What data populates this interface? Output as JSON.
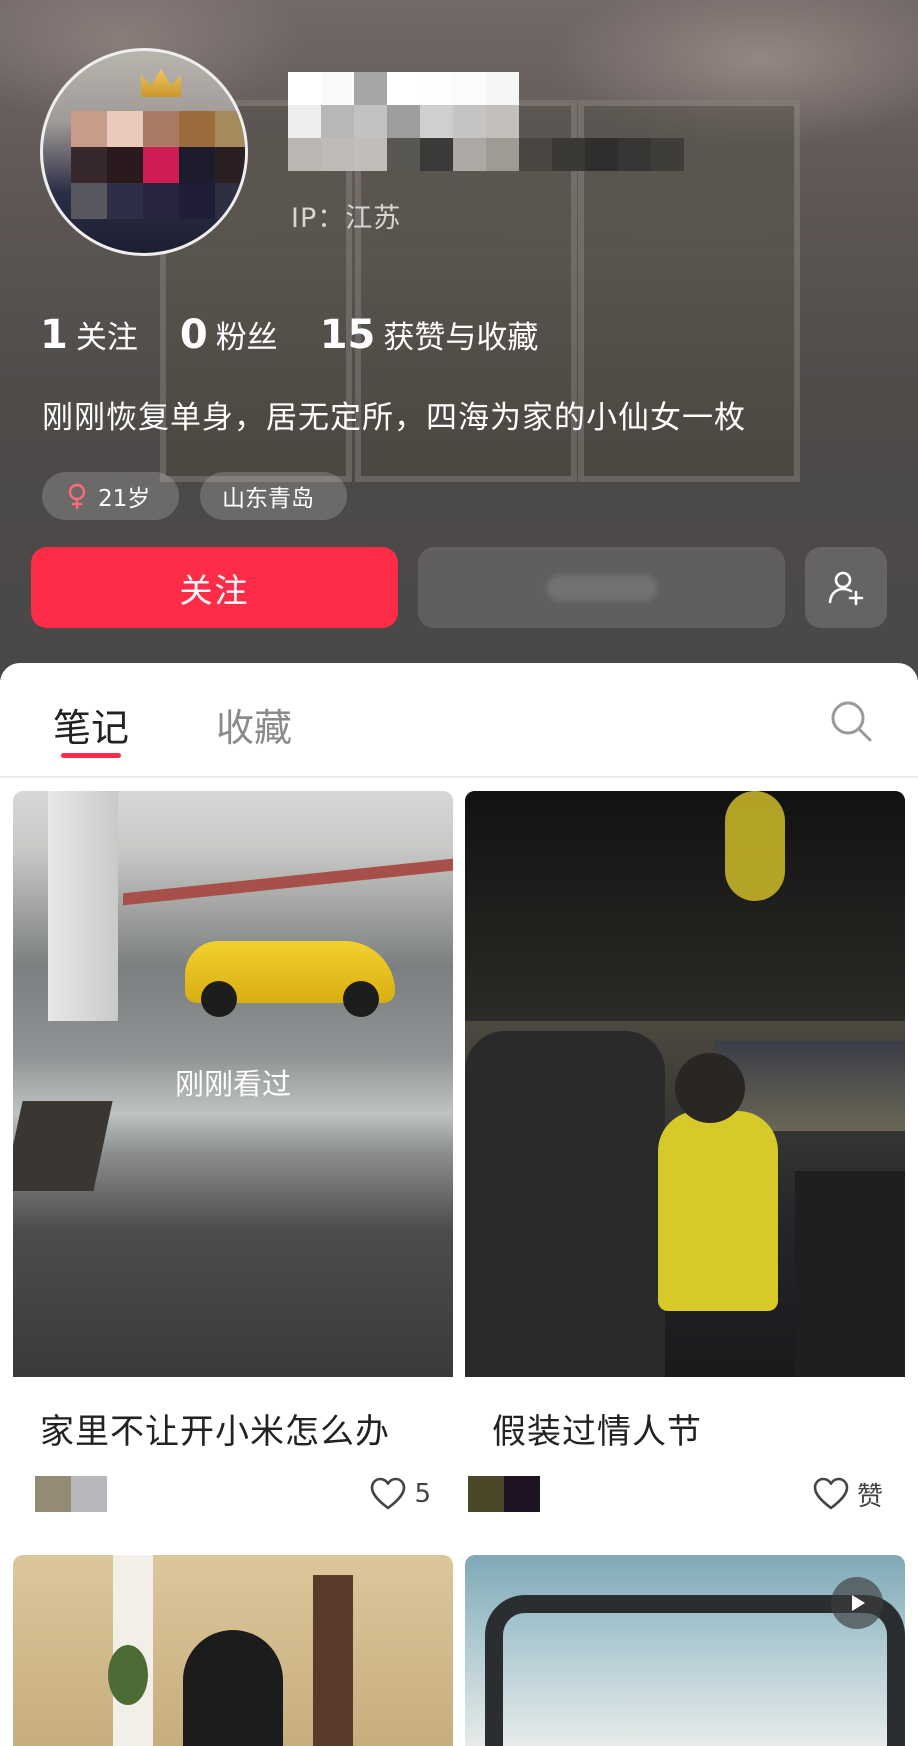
{
  "profile": {
    "ip_label": "IP：江苏",
    "stats": [
      {
        "num": "1",
        "label": "关注"
      },
      {
        "num": "0",
        "label": "粉丝"
      },
      {
        "num": "15",
        "label": "获赞与收藏"
      }
    ],
    "bio": "刚刚恢复单身，居无定所，四海为家的小仙女一枚",
    "tags": {
      "age": "21岁",
      "location": "山东青岛"
    },
    "follow_label": "关注",
    "colors": {
      "accent": "#fe2c47"
    },
    "icons": {
      "gender": "female-icon",
      "add_friend": "add-user-icon"
    }
  },
  "tabs": [
    {
      "label": "笔记",
      "active": true
    },
    {
      "label": "收藏",
      "active": false
    }
  ],
  "notes": [
    {
      "title": "家里不让开小米怎么办",
      "overlay": "刚刚看过",
      "likes": "5"
    },
    {
      "title": "假装过情人节",
      "likes": "赞"
    },
    {
      "title": ""
    },
    {
      "title": "",
      "is_video": true
    }
  ]
}
